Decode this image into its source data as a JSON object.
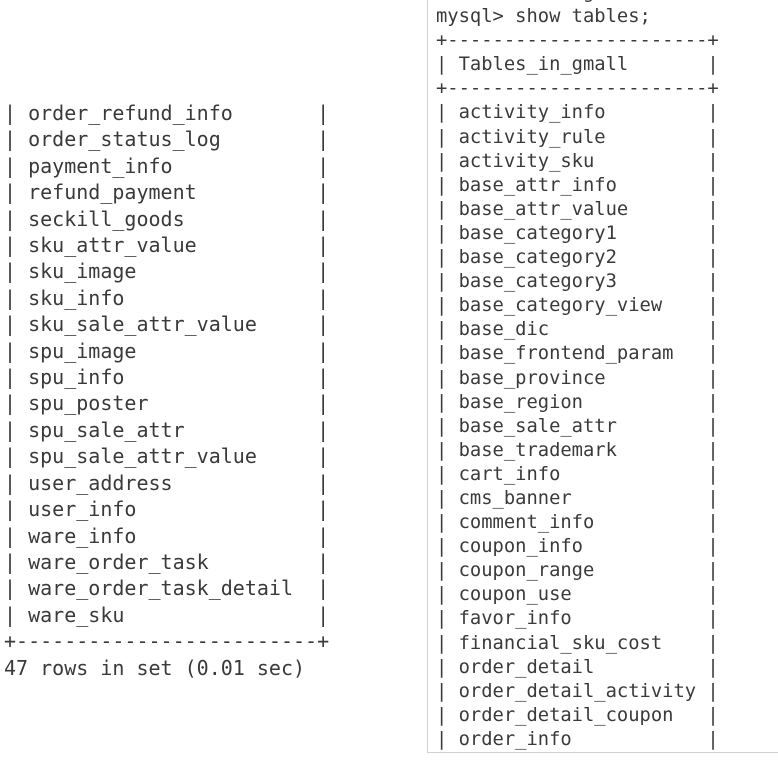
{
  "left_panel": {
    "lines": [
      "| order_refund_info       |",
      "| order_status_log        |",
      "| payment_info            |",
      "| refund_payment          |",
      "| seckill_goods           |",
      "| sku_attr_value          |",
      "| sku_image               |",
      "| sku_info                |",
      "| sku_sale_attr_value     |",
      "| spu_image               |",
      "| spu_info                |",
      "| spu_poster              |",
      "| spu_sale_attr           |",
      "| spu_sale_attr_value     |",
      "| user_address            |",
      "| user_info               |",
      "| ware_info               |",
      "| ware_order_task         |",
      "| ware_order_task_detail  |",
      "| ware_sku                |",
      "+-------------------------+",
      "47 rows in set (0.01 sec)"
    ]
  },
  "right_panel": {
    "lines": [
      "Database changed",
      "mysql> show tables;",
      "+-----------------------+",
      "| Tables_in_gmall       |",
      "+-----------------------+",
      "| activity_info         |",
      "| activity_rule         |",
      "| activity_sku          |",
      "| base_attr_info        |",
      "| base_attr_value       |",
      "| base_category1        |",
      "| base_category2        |",
      "| base_category3        |",
      "| base_category_view    |",
      "| base_dic              |",
      "| base_frontend_param   |",
      "| base_province         |",
      "| base_region           |",
      "| base_sale_attr        |",
      "| base_trademark        |",
      "| cart_info             |",
      "| cms_banner            |",
      "| comment_info          |",
      "| coupon_info           |",
      "| coupon_range          |",
      "| coupon_use            |",
      "| favor_info            |",
      "| financial_sku_cost    |",
      "| order_detail          |",
      "| order_detail_activity |",
      "| order_detail_coupon   |",
      "| order_info            |"
    ]
  }
}
